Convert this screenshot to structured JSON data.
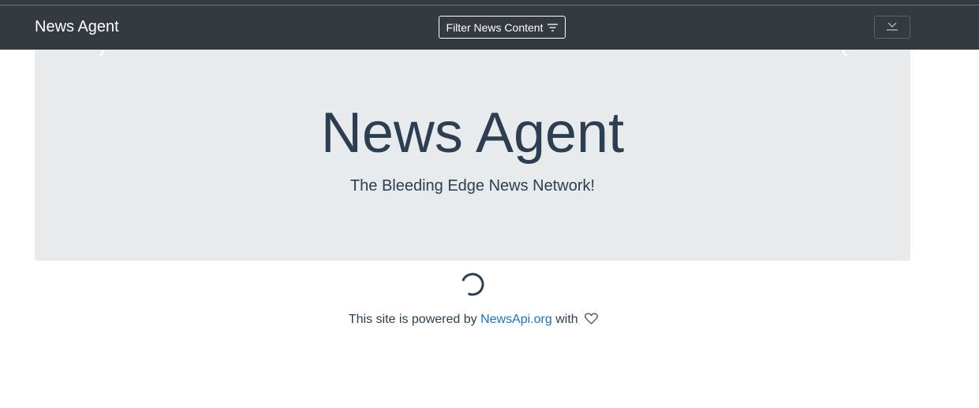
{
  "navbar": {
    "brand": "News Agent",
    "filter_button_label": "Filter News Content",
    "filter_icon": "filter-lines-icon",
    "download_icon": "download-icon"
  },
  "hero": {
    "title": "News Agent",
    "subtitle": "The Bleeding Edge News Network!"
  },
  "loading": {
    "icon": "spinner-icon"
  },
  "footer": {
    "prefix": "This site is powered by",
    "link_text": "NewsApi.org",
    "suffix": "with",
    "heart_icon": "heart-icon"
  },
  "colors": {
    "navbar_bg": "#343a40",
    "jumbotron_bg": "#e8ebee",
    "text_primary": "#2c3e50",
    "link": "#1a73c8"
  }
}
